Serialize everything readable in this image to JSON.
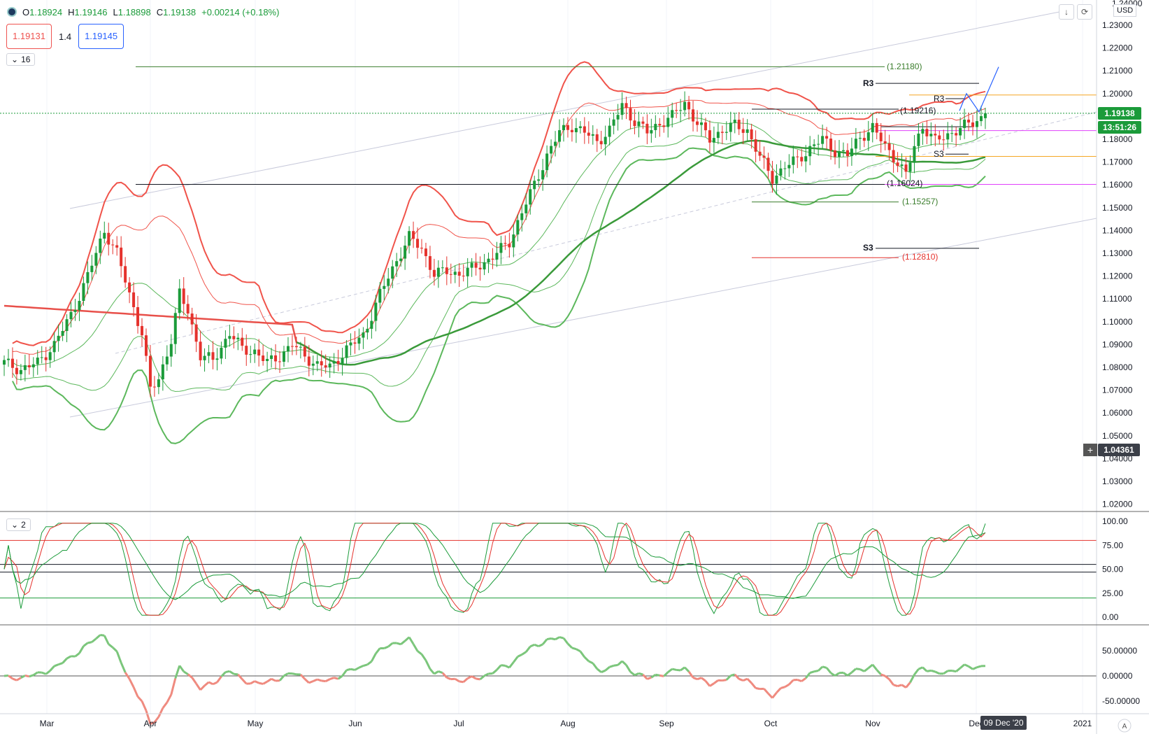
{
  "header": {
    "ohlc": [
      {
        "key": "O",
        "value": "1.18924"
      },
      {
        "key": "H",
        "value": "1.19146"
      },
      {
        "key": "L",
        "value": "1.18898"
      },
      {
        "key": "C",
        "value": "1.19138"
      }
    ],
    "change": "+0.00214 (+0.18%)",
    "bid": "1.19131",
    "spread": "1.4",
    "ask": "1.19145",
    "indicator_count": "16",
    "oscillator_indicator_count": "2",
    "currency": "USD",
    "axis_top_partial": "1.24000"
  },
  "colors": {
    "up": "#1b9b3a",
    "down": "#e5322d",
    "bb_upper": "#f0534a",
    "bb_lower": "#5cb85c",
    "ma_green": "#3a9a3a",
    "ma_red": "#e8504a",
    "orange": "#f5a623",
    "magenta": "#e040fb",
    "blue_path": "#2962ff"
  },
  "price_axis": {
    "labels": [
      "1.23000",
      "1.22000",
      "1.21000",
      "1.20000",
      "1.19000",
      "1.18000",
      "1.17000",
      "1.16000",
      "1.15000",
      "1.14000",
      "1.13000",
      "1.12000",
      "1.11000",
      "1.10000",
      "1.09000",
      "1.08000",
      "1.07000",
      "1.06000",
      "1.05000",
      "1.04000",
      "1.03000",
      "1.02000"
    ],
    "current_price": "1.19138",
    "countdown": "13:51:26",
    "cursor_price": "1.04361"
  },
  "time_axis": {
    "labels": [
      "Mar",
      "Apr",
      "May",
      "Jun",
      "Jul",
      "Aug",
      "Sep",
      "Oct",
      "Nov",
      "Dec",
      "2021"
    ],
    "cursor_label": "09 Dec '20"
  },
  "stoch_axis": {
    "labels": [
      "100.00",
      "75.00",
      "50.00",
      "25.00",
      "0.00"
    ]
  },
  "macd_axis": {
    "labels": [
      "50.00000",
      "0.00000",
      "-50.00000"
    ]
  },
  "level_labels": {
    "l12118": "(1.21180)",
    "r3a": "R3",
    "r3b": "R3",
    "l11921": "(1.19216)",
    "s3a": "S3",
    "s3b": "S3",
    "l11602": "(1.16024)",
    "l11525": "(1.15257)",
    "l11281": "(1.12810)"
  },
  "chart_data": {
    "type": "candlestick",
    "symbol_quote": "USD",
    "price_range": [
      1.015,
      1.24
    ],
    "last": {
      "open": 1.18924,
      "high": 1.19146,
      "low": 1.18898,
      "close": 1.19138
    },
    "levels": [
      1.2118,
      1.19216,
      1.16024,
      1.15257,
      1.1281
    ],
    "months": [
      "Mar",
      "Apr",
      "May",
      "Jun",
      "Jul",
      "Aug",
      "Sep",
      "Oct",
      "Nov",
      "Dec",
      "2021"
    ],
    "close_path": [
      [
        0,
        1.082
      ],
      [
        4,
        1.079
      ],
      [
        8,
        1.082
      ],
      [
        12,
        1.09
      ],
      [
        16,
        1.103
      ],
      [
        20,
        1.12
      ],
      [
        24,
        1.14
      ],
      [
        27,
        1.13
      ],
      [
        30,
        1.112
      ],
      [
        33,
        1.095
      ],
      [
        35,
        1.07
      ],
      [
        37,
        1.075
      ],
      [
        40,
        1.092
      ],
      [
        42,
        1.112
      ],
      [
        44,
        1.105
      ],
      [
        47,
        1.085
      ],
      [
        50,
        1.083
      ],
      [
        54,
        1.095
      ],
      [
        57,
        1.088
      ],
      [
        60,
        1.087
      ],
      [
        63,
        1.082
      ],
      [
        66,
        1.085
      ],
      [
        69,
        1.09
      ],
      [
        72,
        1.085
      ],
      [
        75,
        1.081
      ],
      [
        78,
        1.08
      ],
      [
        82,
        1.088
      ],
      [
        86,
        1.094
      ],
      [
        90,
        1.112
      ],
      [
        94,
        1.127
      ],
      [
        97,
        1.137
      ],
      [
        100,
        1.132
      ],
      [
        103,
        1.121
      ],
      [
        106,
        1.122
      ],
      [
        109,
        1.121
      ],
      [
        112,
        1.123
      ],
      [
        115,
        1.126
      ],
      [
        118,
        1.13
      ],
      [
        121,
        1.135
      ],
      [
        124,
        1.148
      ],
      [
        127,
        1.16
      ],
      [
        130,
        1.173
      ],
      [
        133,
        1.183
      ],
      [
        136,
        1.186
      ],
      [
        139,
        1.183
      ],
      [
        142,
        1.179
      ],
      [
        145,
        1.184
      ],
      [
        148,
        1.195
      ],
      [
        151,
        1.188
      ],
      [
        154,
        1.183
      ],
      [
        157,
        1.187
      ],
      [
        160,
        1.19
      ],
      [
        163,
        1.196
      ],
      [
        166,
        1.187
      ],
      [
        169,
        1.18
      ],
      [
        172,
        1.184
      ],
      [
        175,
        1.186
      ],
      [
        178,
        1.184
      ],
      [
        181,
        1.172
      ],
      [
        184,
        1.163
      ],
      [
        187,
        1.168
      ],
      [
        190,
        1.171
      ],
      [
        193,
        1.176
      ],
      [
        196,
        1.18
      ],
      [
        199,
        1.175
      ],
      [
        202,
        1.173
      ],
      [
        205,
        1.181
      ],
      [
        208,
        1.185
      ],
      [
        211,
        1.177
      ],
      [
        214,
        1.17
      ],
      [
        216,
        1.164
      ],
      [
        218,
        1.177
      ],
      [
        220,
        1.186
      ],
      [
        223,
        1.179
      ],
      [
        226,
        1.182
      ],
      [
        229,
        1.185
      ],
      [
        232,
        1.187
      ],
      [
        235,
        1.191
      ]
    ],
    "stochastic": {
      "levels": [
        80,
        50,
        20
      ]
    },
    "macd": {
      "zero": 0
    }
  }
}
